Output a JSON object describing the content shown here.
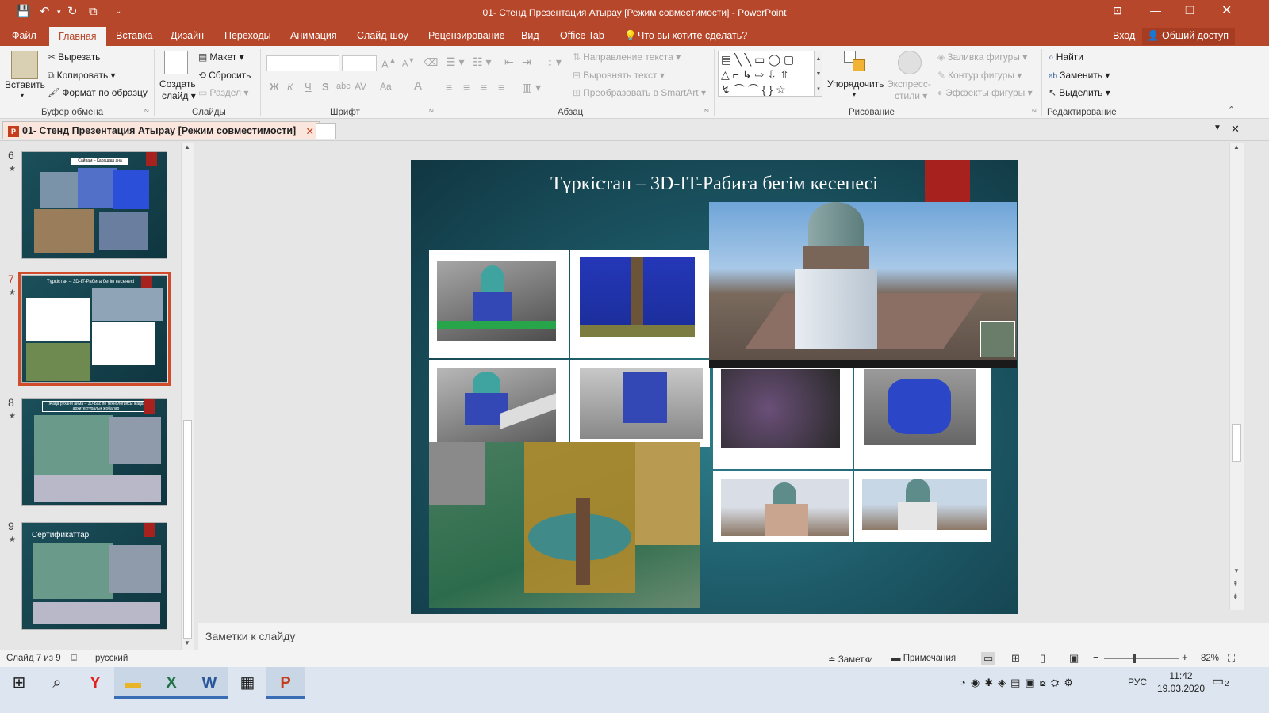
{
  "window": {
    "title": "01- Стенд Презентация Атырау [Режим совместимости] - PowerPoint"
  },
  "menu": {
    "file": "Файл",
    "tabs": [
      "Главная",
      "Вставка",
      "Дизайн",
      "Переходы",
      "Анимация",
      "Слайд-шоу",
      "Рецензирование",
      "Вид",
      "Office Tab"
    ],
    "tell_me": "Что вы хотите сделать?",
    "signin": "Вход",
    "share": "Общий доступ"
  },
  "ribbon": {
    "clipboard": {
      "paste": "Вставить",
      "cut": "Вырезать",
      "copy": "Копировать",
      "format_painter": "Формат по образцу",
      "label": "Буфер обмена"
    },
    "slides": {
      "new_slide_1": "Создать",
      "new_slide_2": "слайд",
      "layout": "Макет",
      "reset": "Сбросить",
      "section": "Раздел",
      "label": "Слайды"
    },
    "font": {
      "label": "Шрифт",
      "bold": "Ж",
      "italic": "К",
      "underline": "Ч",
      "shadow": "S",
      "strike": "abc",
      "spacing": "AV",
      "case": "Aa",
      "color": "A"
    },
    "paragraph": {
      "text_direction": "Направление текста",
      "align_text": "Выровнять текст",
      "smartart": "Преобразовать в SmartArt",
      "label": "Абзац"
    },
    "drawing": {
      "arrange": "Упорядочить",
      "quick_styles_1": "Экспресс-",
      "quick_styles_2": "стили",
      "shape_fill": "Заливка фигуры",
      "shape_outline": "Контур фигуры",
      "shape_effects": "Эффекты фигуры",
      "label": "Рисование"
    },
    "editing": {
      "find": "Найти",
      "replace": "Заменить",
      "select": "Выделить",
      "label": "Редактирование"
    }
  },
  "doc_tab": {
    "title": "01- Стенд Презентация Атырау [Режим совместимости]"
  },
  "thumbnails": [
    {
      "num": "6",
      "caption": "Сайрам – Қарашаш ана кесенесі"
    },
    {
      "num": "7",
      "caption": "Түркістан – 3D-IT-Рабиға бегім кесенесі"
    },
    {
      "num": "8",
      "caption": "Жаңа рухани айма – 3D-Бас по технологиясы жаңа архитектуралық жобалар"
    },
    {
      "num": "9",
      "caption": "Сертификаттар"
    }
  ],
  "slide": {
    "title": "Түркістан – 3D-IT-Рабиға бегім кесенесі"
  },
  "notes": {
    "placeholder": "Заметки к слайду"
  },
  "status": {
    "slide_counter": "Слайд 7 из 9",
    "language": "русский",
    "notes_btn": "Заметки",
    "comments_btn": "Примечания",
    "zoom": "82%"
  },
  "taskbar": {
    "lang": "РУС",
    "time": "11:42",
    "date": "19.03.2020",
    "notif": "2"
  }
}
